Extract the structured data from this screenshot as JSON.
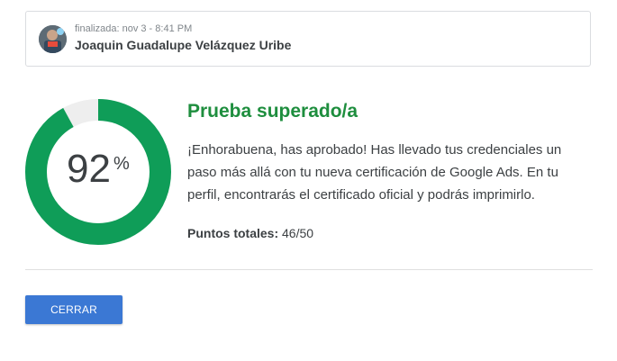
{
  "attempt": {
    "finished_label": "finalizada: nov 3 - 8:41 PM",
    "user_name": "Joaquin Guadalupe Velázquez Uribe"
  },
  "score": {
    "value": "92",
    "unit": "%",
    "fraction": 0.92,
    "ring_color": "#0f9d58",
    "track_color": "#eeeeee"
  },
  "result": {
    "title": "Prueba superado/a",
    "title_color": "#1e8e3e",
    "message": "¡Enhorabuena, has aprobado! Has llevado tus credenciales un paso más allá con tu nueva certificación de Google Ads. En tu perfil, encontrarás el certificado oficial y podrás imprimirlo.",
    "points_label": "Puntos totales:",
    "points_value": "46/50"
  },
  "actions": {
    "close_label": "CERRAR",
    "close_color": "#3b78d4"
  }
}
